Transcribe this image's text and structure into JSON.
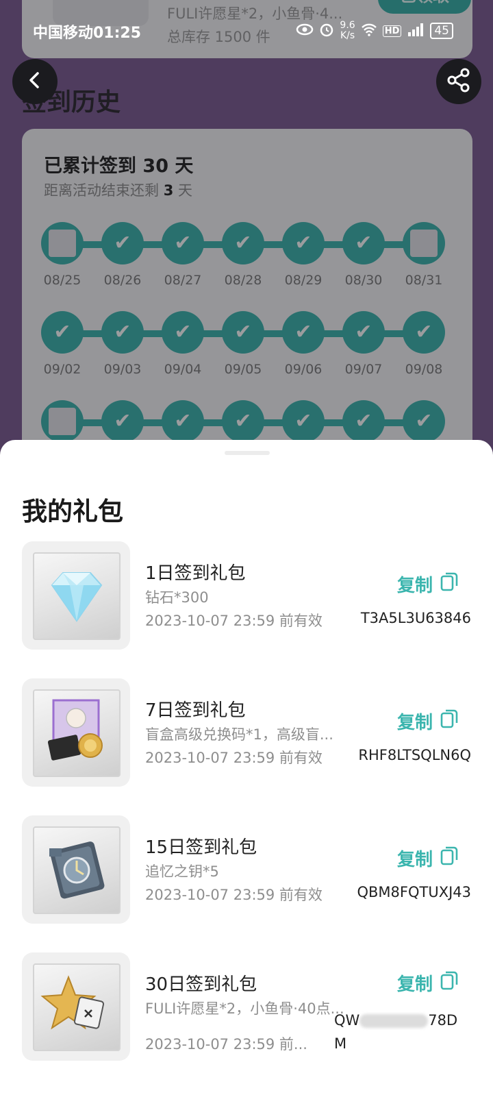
{
  "status_bar": {
    "carrier_time": "中国移动01:25",
    "net_speed_value": "9.6",
    "net_speed_unit": "K/s",
    "battery": "45"
  },
  "background": {
    "top_card_line1": "FULI许愿星*2，小鱼骨·4...",
    "top_card_line2": "总库存 1500 件",
    "top_card_button": "已领取",
    "section_title": "签到历史",
    "total_prefix": "已累计签到",
    "total_days": "30",
    "total_suffix": "天",
    "remaining_prefix": "距离活动结束还剩",
    "remaining_days": "3",
    "remaining_suffix": "天",
    "row1_dates": [
      "08/25",
      "08/26",
      "08/27",
      "08/28",
      "08/29",
      "08/30",
      "08/31"
    ],
    "row2_dates": [
      "09/02",
      "09/03",
      "09/04",
      "09/05",
      "09/06",
      "09/07",
      "09/08"
    ]
  },
  "sheet": {
    "title": "我的礼包",
    "copy_label": "复制",
    "gifts": [
      {
        "name": "1日签到礼包",
        "desc": "钻石*300",
        "expiry": "2023-10-07 23:59 前有效",
        "code": "T3A5L3U63846",
        "icon": "diamond-icon"
      },
      {
        "name": "7日签到礼包",
        "desc": "盲盒高级兑换码*1，高级盲...",
        "expiry": "2023-10-07 23:59 前有效",
        "code": "RHF8LTSQLN6Q",
        "icon": "character-card-icon"
      },
      {
        "name": "15日签到礼包",
        "desc": "追忆之钥*5",
        "expiry": "2023-10-07 23:59 前有效",
        "code": "QBM8FQTUXJ43",
        "icon": "key-icon"
      },
      {
        "name": "30日签到礼包",
        "desc": "FULI许愿星*2，小鱼骨·40点...",
        "expiry": "2023-10-07 23:59 前...",
        "code_start": "QW",
        "code_end": "78D",
        "code_line2": "M",
        "icon": "star-icon"
      }
    ]
  },
  "colors": {
    "accent": "#39b4ad",
    "purple_bg": "#7b5a92"
  }
}
